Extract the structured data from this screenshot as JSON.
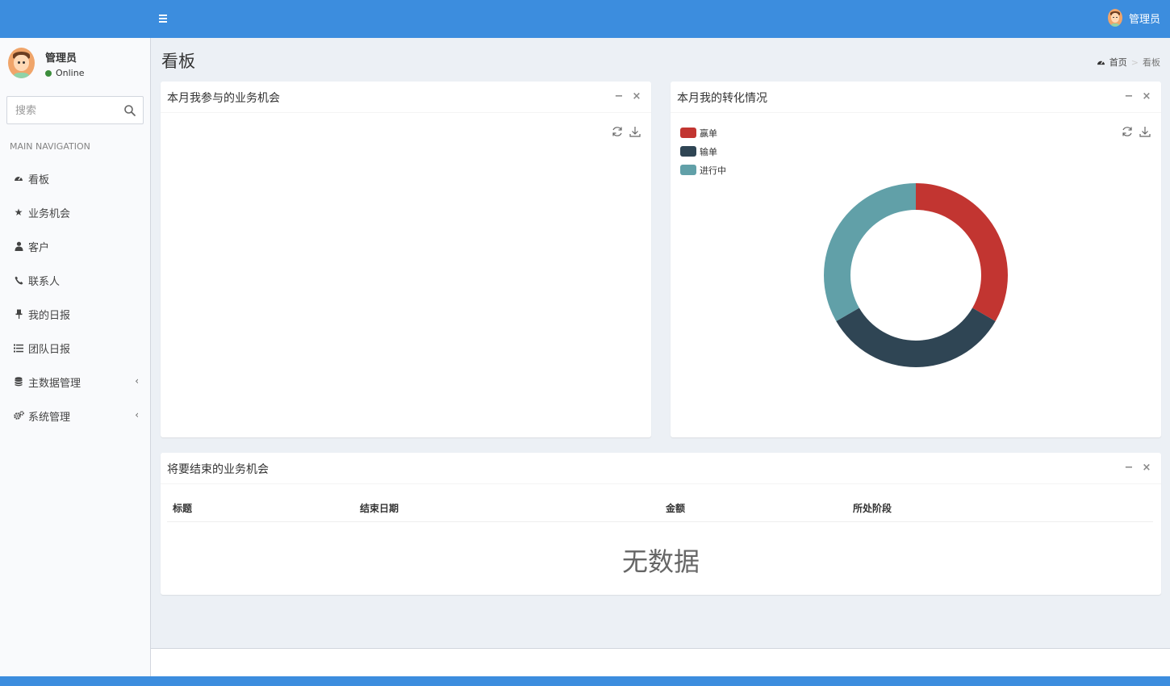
{
  "header": {
    "user_name": "管理员"
  },
  "sidebar": {
    "user": {
      "name": "管理员",
      "status": "Online",
      "status_color": "#3c8d3c"
    },
    "search": {
      "placeholder": "搜索"
    },
    "nav_header": "MAIN NAVIGATION",
    "items": [
      {
        "label": "看板",
        "icon": "dashboard-icon",
        "has_submenu": false
      },
      {
        "label": "业务机会",
        "icon": "star-icon",
        "has_submenu": false
      },
      {
        "label": "客户",
        "icon": "user-icon",
        "has_submenu": false
      },
      {
        "label": "联系人",
        "icon": "phone-icon",
        "has_submenu": false
      },
      {
        "label": "我的日报",
        "icon": "pin-icon",
        "has_submenu": false
      },
      {
        "label": "团队日报",
        "icon": "list-icon",
        "has_submenu": false
      },
      {
        "label": "主数据管理",
        "icon": "database-icon",
        "has_submenu": true
      },
      {
        "label": "系统管理",
        "icon": "cogs-icon",
        "has_submenu": true
      }
    ]
  },
  "content": {
    "title": "看板",
    "breadcrumb": {
      "home": "首页",
      "current": "看板"
    }
  },
  "boxes": {
    "opportunities": {
      "title": "本月我参与的业务机会"
    },
    "conversion": {
      "title": "本月我的转化情况"
    },
    "ending": {
      "title": "将要结束的业务机会",
      "columns": [
        "标题",
        "结束日期",
        "金额",
        "所处阶段"
      ],
      "empty_text": "无数据"
    }
  },
  "chart_data": {
    "type": "pie",
    "donut": true,
    "categories": [
      "赢单",
      "输单",
      "进行中"
    ],
    "values": [
      1,
      1,
      1
    ],
    "colors": [
      "#c23531",
      "#2f4554",
      "#61a0a8"
    ],
    "legend_position": "top-left"
  },
  "colors": {
    "header_bg": "#3c8dde",
    "sidebar_bg": "#f9fafc",
    "content_bg": "#ecf0f5"
  }
}
